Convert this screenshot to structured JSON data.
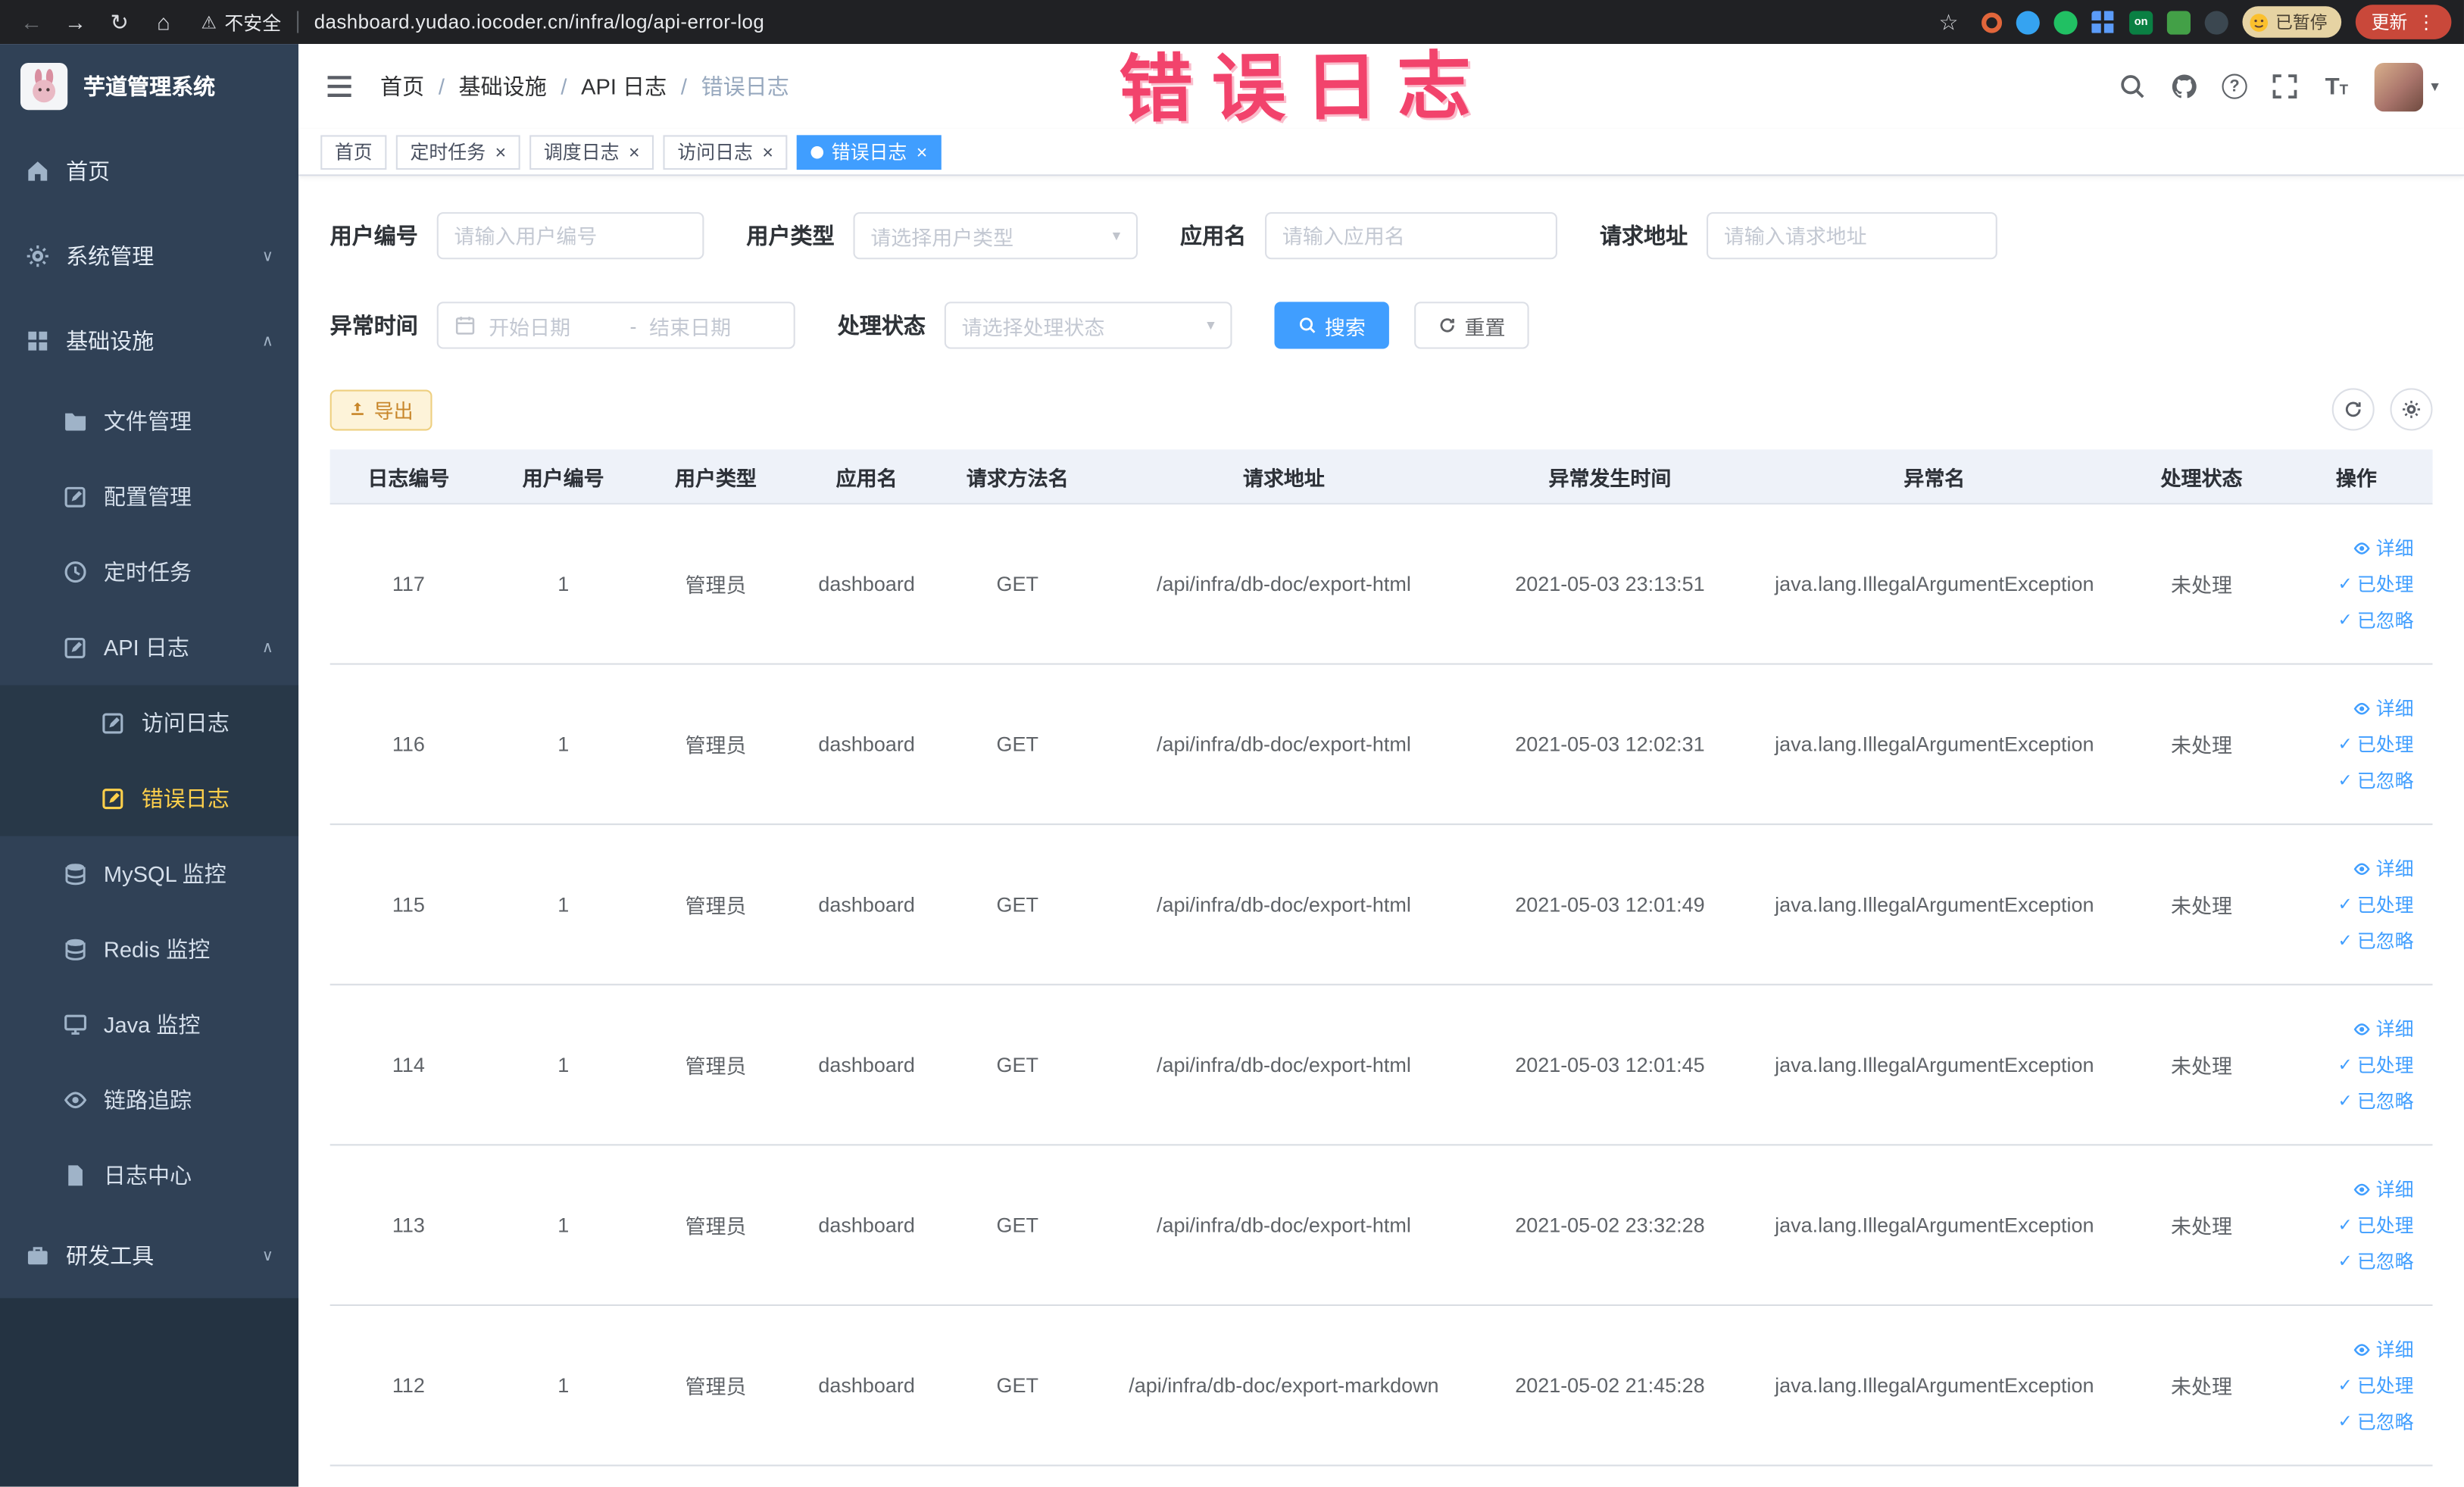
{
  "browser": {
    "security_warning": "不安全",
    "url": "dashboard.yudao.iocoder.cn/infra/log/api-error-log",
    "extension_on_label": "on",
    "paused_badge": "已暂停",
    "update_button": "更新"
  },
  "annotation": {
    "text": "错误日志"
  },
  "sidebar": {
    "logo_title": "芋道管理系统",
    "items": [
      {
        "key": "home",
        "label": "首页",
        "icon": "home",
        "level": 1
      },
      {
        "key": "system-management",
        "label": "系统管理",
        "icon": "gear",
        "level": 1,
        "chevron": "down"
      },
      {
        "key": "infrastructure",
        "label": "基础设施",
        "icon": "grid",
        "level": 1,
        "chevron": "up"
      },
      {
        "key": "file-management",
        "label": "文件管理",
        "icon": "folder",
        "level": 2
      },
      {
        "key": "config-management",
        "label": "配置管理",
        "icon": "edit",
        "level": 2
      },
      {
        "key": "scheduled-tasks",
        "label": "定时任务",
        "icon": "clock",
        "level": 2
      },
      {
        "key": "api-logs",
        "label": "API 日志",
        "icon": "edit",
        "level": 2,
        "chevron": "up"
      },
      {
        "key": "access-log",
        "label": "访问日志",
        "icon": "edit",
        "level": 3
      },
      {
        "key": "error-log",
        "label": "错误日志",
        "icon": "edit",
        "level": 3,
        "active": true
      },
      {
        "key": "mysql-monitor",
        "label": "MySQL 监控",
        "icon": "db",
        "level": 2
      },
      {
        "key": "redis-monitor",
        "label": "Redis 监控",
        "icon": "db",
        "level": 2
      },
      {
        "key": "java-monitor",
        "label": "Java 监控",
        "icon": "monitor",
        "level": 2
      },
      {
        "key": "trace",
        "label": "链路追踪",
        "icon": "eye",
        "level": 2
      },
      {
        "key": "log-center",
        "label": "日志中心",
        "icon": "doc",
        "level": 2
      },
      {
        "key": "dev-tools",
        "label": "研发工具",
        "icon": "briefcase",
        "level": 1,
        "chevron": "down"
      }
    ]
  },
  "header": {
    "breadcrumb": [
      "首页",
      "基础设施",
      "API 日志",
      "错误日志"
    ]
  },
  "tabs": [
    {
      "key": "home",
      "label": "首页",
      "closable": false,
      "active": false
    },
    {
      "key": "scheduled-tasks",
      "label": "定时任务",
      "closable": true,
      "active": false
    },
    {
      "key": "schedule-log",
      "label": "调度日志",
      "closable": true,
      "active": false
    },
    {
      "key": "access-log",
      "label": "访问日志",
      "closable": true,
      "active": false
    },
    {
      "key": "error-log",
      "label": "错误日志",
      "closable": true,
      "active": true
    }
  ],
  "filters": {
    "user_id": {
      "label": "用户编号",
      "placeholder": "请输入用户编号"
    },
    "user_type": {
      "label": "用户类型",
      "placeholder": "请选择用户类型"
    },
    "app_name": {
      "label": "应用名",
      "placeholder": "请输入应用名"
    },
    "request_url": {
      "label": "请求地址",
      "placeholder": "请输入请求地址"
    },
    "exception_time": {
      "label": "异常时间",
      "start_placeholder": "开始日期",
      "separator": "-",
      "end_placeholder": "结束日期"
    },
    "process_status": {
      "label": "处理状态",
      "placeholder": "请选择处理状态"
    },
    "search_button": "搜索",
    "reset_button": "重置"
  },
  "toolbar": {
    "export_button": "导出"
  },
  "table": {
    "headers": [
      "日志编号",
      "用户编号",
      "用户类型",
      "应用名",
      "请求方法名",
      "请求地址",
      "异常发生时间",
      "异常名",
      "处理状态",
      "操作"
    ],
    "actions": {
      "detail": "详细",
      "processed": "已处理",
      "ignored": "已忽略"
    },
    "rows": [
      {
        "id": "117",
        "user_id": "1",
        "user_type": "管理员",
        "app": "dashboard",
        "method": "GET",
        "url": "/api/infra/db-doc/export-html",
        "time": "2021-05-03 23:13:51",
        "exception": "java.lang.IllegalArgumentException",
        "status": "未处理"
      },
      {
        "id": "116",
        "user_id": "1",
        "user_type": "管理员",
        "app": "dashboard",
        "method": "GET",
        "url": "/api/infra/db-doc/export-html",
        "time": "2021-05-03 12:02:31",
        "exception": "java.lang.IllegalArgumentException",
        "status": "未处理"
      },
      {
        "id": "115",
        "user_id": "1",
        "user_type": "管理员",
        "app": "dashboard",
        "method": "GET",
        "url": "/api/infra/db-doc/export-html",
        "time": "2021-05-03 12:01:49",
        "exception": "java.lang.IllegalArgumentException",
        "status": "未处理"
      },
      {
        "id": "114",
        "user_id": "1",
        "user_type": "管理员",
        "app": "dashboard",
        "method": "GET",
        "url": "/api/infra/db-doc/export-html",
        "time": "2021-05-03 12:01:45",
        "exception": "java.lang.IllegalArgumentException",
        "status": "未处理"
      },
      {
        "id": "113",
        "user_id": "1",
        "user_type": "管理员",
        "app": "dashboard",
        "method": "GET",
        "url": "/api/infra/db-doc/export-html",
        "time": "2021-05-02 23:32:28",
        "exception": "java.lang.IllegalArgumentException",
        "status": "未处理"
      },
      {
        "id": "112",
        "user_id": "1",
        "user_type": "管理员",
        "app": "dashboard",
        "method": "GET",
        "url": "/api/infra/db-doc/export-markdown",
        "time": "2021-05-02 21:45:28",
        "exception": "java.lang.IllegalArgumentException",
        "status": "未处理"
      }
    ]
  }
}
